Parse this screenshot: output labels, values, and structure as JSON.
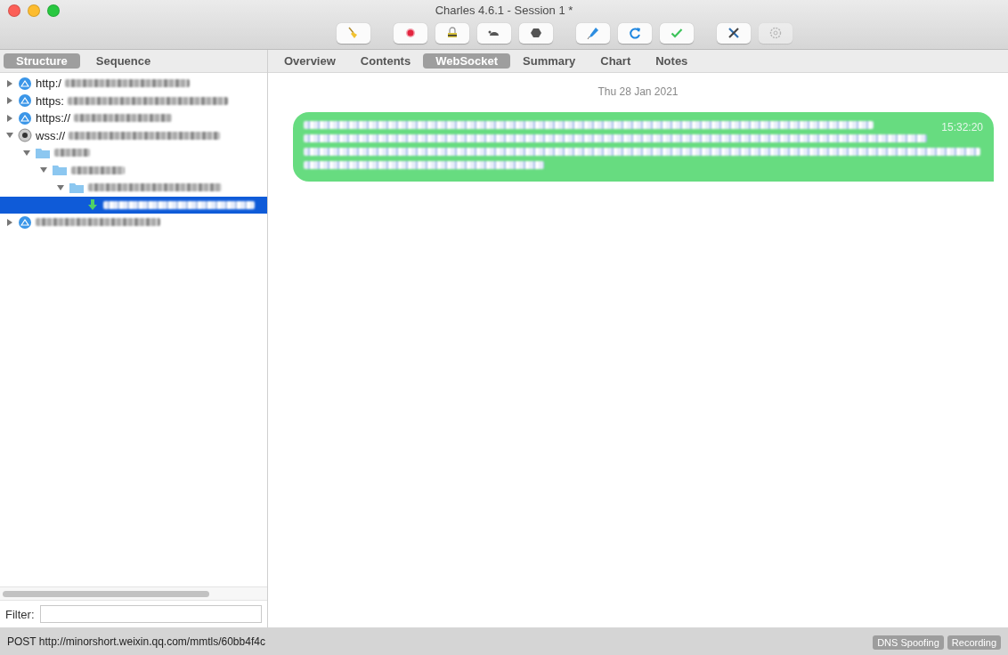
{
  "window": {
    "title": "Charles 4.6.1 - Session 1 *"
  },
  "toolbar": [
    {
      "buttons": [
        {
          "kind": "broom",
          "disabled": false
        }
      ]
    },
    {
      "buttons": [
        {
          "kind": "record",
          "disabled": false
        },
        {
          "kind": "lock",
          "disabled": false
        },
        {
          "kind": "turtle",
          "disabled": false
        },
        {
          "kind": "stop",
          "disabled": false
        }
      ]
    },
    {
      "buttons": [
        {
          "kind": "pen",
          "disabled": false
        },
        {
          "kind": "refresh",
          "disabled": false
        },
        {
          "kind": "check",
          "disabled": false
        }
      ]
    },
    {
      "buttons": [
        {
          "kind": "tools",
          "disabled": false
        },
        {
          "kind": "settings",
          "disabled": true
        }
      ]
    }
  ],
  "sidebar": {
    "tabs": [
      {
        "label": "Structure",
        "selected": true
      },
      {
        "label": "Sequence",
        "selected": false
      }
    ],
    "tree": [
      {
        "kind": "host",
        "label": "http:/",
        "expanded": false,
        "selected": false
      },
      {
        "kind": "host",
        "label": "https:",
        "expanded": false,
        "selected": false
      },
      {
        "kind": "host",
        "label": "https://",
        "expanded": false,
        "selected": false
      },
      {
        "kind": "socket",
        "label": "wss://",
        "expanded": true,
        "selected": false,
        "children": [
          {
            "kind": "folder",
            "expanded": true,
            "selected": false,
            "children": [
              {
                "kind": "folder",
                "expanded": true,
                "selected": false,
                "children": [
                  {
                    "kind": "folder",
                    "expanded": true,
                    "selected": false,
                    "children": [
                      {
                        "kind": "message",
                        "selected": true
                      }
                    ]
                  }
                ]
              }
            ]
          }
        ]
      },
      {
        "kind": "host",
        "expanded": false,
        "selected": false
      }
    ],
    "filter": {
      "label": "Filter:"
    }
  },
  "detail": {
    "tabs": [
      {
        "label": "Overview",
        "selected": false
      },
      {
        "label": "Contents",
        "selected": false
      },
      {
        "label": "WebSocket",
        "selected": true
      },
      {
        "label": "Summary",
        "selected": false
      },
      {
        "label": "Chart",
        "selected": false
      },
      {
        "label": "Notes",
        "selected": false
      }
    ],
    "date": "Thu 28 Jan 2021",
    "messages": [
      {
        "time": "15:32:20"
      }
    ]
  },
  "status_bar": {
    "text": "POST http://minorshort.weixin.qq.com/mmtls/60bb4f4c",
    "badges": [
      "DNS Spoofing",
      "Recording"
    ]
  }
}
